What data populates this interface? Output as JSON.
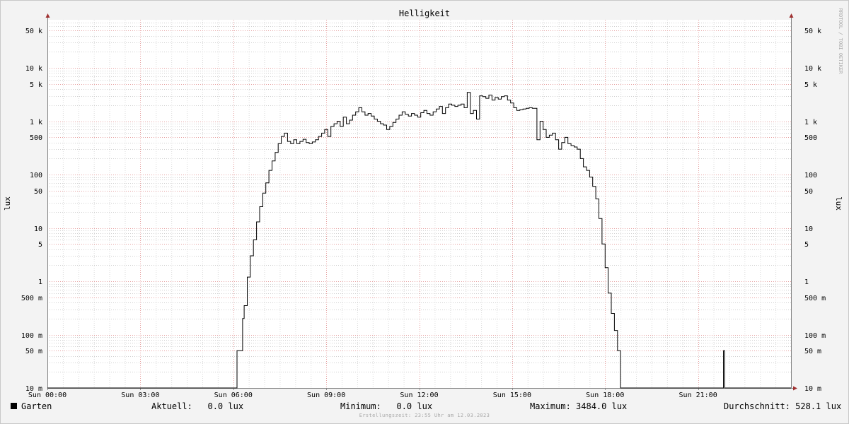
{
  "chart_data": {
    "type": "line",
    "title": "Helligkeit",
    "ylabel": "lux",
    "ylabel_right": "lux",
    "yscale": "log",
    "ylim": [
      0.01,
      80000
    ],
    "xlim": [
      0,
      24
    ],
    "x_ticks": [
      {
        "value": 0,
        "label": "Sun 00:00"
      },
      {
        "value": 3,
        "label": "Sun 03:00"
      },
      {
        "value": 6,
        "label": "Sun 06:00"
      },
      {
        "value": 9,
        "label": "Sun 09:00"
      },
      {
        "value": 12,
        "label": "Sun 12:00"
      },
      {
        "value": 15,
        "label": "Sun 15:00"
      },
      {
        "value": 18,
        "label": "Sun 18:00"
      },
      {
        "value": 21,
        "label": "Sun 21:00"
      }
    ],
    "y_ticks": [
      {
        "value": 0.01,
        "label": "10 m"
      },
      {
        "value": 0.05,
        "label": "50 m"
      },
      {
        "value": 0.1,
        "label": "100 m"
      },
      {
        "value": 0.5,
        "label": "500 m"
      },
      {
        "value": 1,
        "label": "1"
      },
      {
        "value": 5,
        "label": "5"
      },
      {
        "value": 10,
        "label": "10"
      },
      {
        "value": 50,
        "label": "50"
      },
      {
        "value": 100,
        "label": "100"
      },
      {
        "value": 500,
        "label": "500"
      },
      {
        "value": 1000,
        "label": "1 k"
      },
      {
        "value": 5000,
        "label": "5 k"
      },
      {
        "value": 10000,
        "label": "10 k"
      },
      {
        "value": 50000,
        "label": "50 k"
      }
    ],
    "grid": true,
    "series": [
      {
        "name": "Garten",
        "color": "#000000",
        "step": true,
        "points": [
          [
            0,
            0.01
          ],
          [
            6.1,
            0.01
          ],
          [
            6.12,
            0.05
          ],
          [
            6.28,
            0.05
          ],
          [
            6.3,
            0.2
          ],
          [
            6.35,
            0.35
          ],
          [
            6.45,
            1.2
          ],
          [
            6.55,
            3
          ],
          [
            6.65,
            6
          ],
          [
            6.75,
            13
          ],
          [
            6.85,
            25
          ],
          [
            6.95,
            45
          ],
          [
            7.05,
            70
          ],
          [
            7.15,
            120
          ],
          [
            7.25,
            180
          ],
          [
            7.35,
            260
          ],
          [
            7.45,
            380
          ],
          [
            7.55,
            520
          ],
          [
            7.65,
            600
          ],
          [
            7.75,
            420
          ],
          [
            7.85,
            380
          ],
          [
            7.95,
            450
          ],
          [
            8.05,
            380
          ],
          [
            8.15,
            420
          ],
          [
            8.25,
            460
          ],
          [
            8.35,
            400
          ],
          [
            8.45,
            380
          ],
          [
            8.55,
            410
          ],
          [
            8.65,
            450
          ],
          [
            8.75,
            520
          ],
          [
            8.85,
            600
          ],
          [
            8.95,
            700
          ],
          [
            9.05,
            520
          ],
          [
            9.15,
            800
          ],
          [
            9.25,
            900
          ],
          [
            9.35,
            1000
          ],
          [
            9.45,
            800
          ],
          [
            9.55,
            1200
          ],
          [
            9.65,
            900
          ],
          [
            9.75,
            1050
          ],
          [
            9.85,
            1300
          ],
          [
            9.95,
            1500
          ],
          [
            10.05,
            1800
          ],
          [
            10.15,
            1500
          ],
          [
            10.25,
            1300
          ],
          [
            10.35,
            1400
          ],
          [
            10.45,
            1250
          ],
          [
            10.55,
            1100
          ],
          [
            10.65,
            1000
          ],
          [
            10.75,
            900
          ],
          [
            10.85,
            850
          ],
          [
            10.95,
            700
          ],
          [
            11.05,
            800
          ],
          [
            11.15,
            950
          ],
          [
            11.25,
            1100
          ],
          [
            11.35,
            1300
          ],
          [
            11.45,
            1500
          ],
          [
            11.55,
            1350
          ],
          [
            11.65,
            1250
          ],
          [
            11.75,
            1400
          ],
          [
            11.85,
            1300
          ],
          [
            11.95,
            1200
          ],
          [
            12.05,
            1450
          ],
          [
            12.15,
            1600
          ],
          [
            12.25,
            1400
          ],
          [
            12.35,
            1300
          ],
          [
            12.45,
            1500
          ],
          [
            12.55,
            1700
          ],
          [
            12.65,
            1900
          ],
          [
            12.75,
            1400
          ],
          [
            12.85,
            1800
          ],
          [
            12.95,
            2100
          ],
          [
            13.05,
            2000
          ],
          [
            13.15,
            1900
          ],
          [
            13.25,
            2000
          ],
          [
            13.35,
            2100
          ],
          [
            13.45,
            1800
          ],
          [
            13.55,
            3484
          ],
          [
            13.65,
            1400
          ],
          [
            13.75,
            1600
          ],
          [
            13.85,
            1100
          ],
          [
            13.95,
            3000
          ],
          [
            14.05,
            2900
          ],
          [
            14.15,
            2700
          ],
          [
            14.25,
            3100
          ],
          [
            14.35,
            2500
          ],
          [
            14.45,
            2800
          ],
          [
            14.55,
            2600
          ],
          [
            14.65,
            2900
          ],
          [
            14.75,
            3000
          ],
          [
            14.85,
            2500
          ],
          [
            14.95,
            2200
          ],
          [
            15.05,
            1800
          ],
          [
            15.15,
            1600
          ],
          [
            15.25,
            1650
          ],
          [
            15.35,
            1700
          ],
          [
            15.45,
            1750
          ],
          [
            15.55,
            1800
          ],
          [
            15.65,
            1750
          ],
          [
            15.8,
            450
          ],
          [
            15.9,
            1000
          ],
          [
            16.0,
            700
          ],
          [
            16.1,
            500
          ],
          [
            16.2,
            550
          ],
          [
            16.3,
            600
          ],
          [
            16.4,
            450
          ],
          [
            16.5,
            300
          ],
          [
            16.6,
            400
          ],
          [
            16.7,
            500
          ],
          [
            16.8,
            380
          ],
          [
            16.9,
            350
          ],
          [
            17.0,
            330
          ],
          [
            17.1,
            300
          ],
          [
            17.2,
            200
          ],
          [
            17.3,
            140
          ],
          [
            17.4,
            120
          ],
          [
            17.5,
            90
          ],
          [
            17.6,
            60
          ],
          [
            17.7,
            35
          ],
          [
            17.8,
            15
          ],
          [
            17.9,
            5
          ],
          [
            18.0,
            1.8
          ],
          [
            18.1,
            0.6
          ],
          [
            18.2,
            0.25
          ],
          [
            18.3,
            0.12
          ],
          [
            18.4,
            0.05
          ],
          [
            18.5,
            0.01
          ],
          [
            21.8,
            0.01
          ],
          [
            21.82,
            0.05
          ],
          [
            21.86,
            0.01
          ],
          [
            24,
            0.01
          ]
        ]
      }
    ]
  },
  "legend": {
    "series_name": "Garten",
    "current": "Aktuell:   0.0 lux",
    "minimum": "Minimum:   0.0 lux",
    "maximum": "Maximum: 3484.0 lux",
    "average": "Durchschnitt: 528.1 lux"
  },
  "footer": "Erstellungszeit: 23:55 Uhr am 12.03.2023",
  "watermark": "RRDTOOL / TOBI OETIKER"
}
